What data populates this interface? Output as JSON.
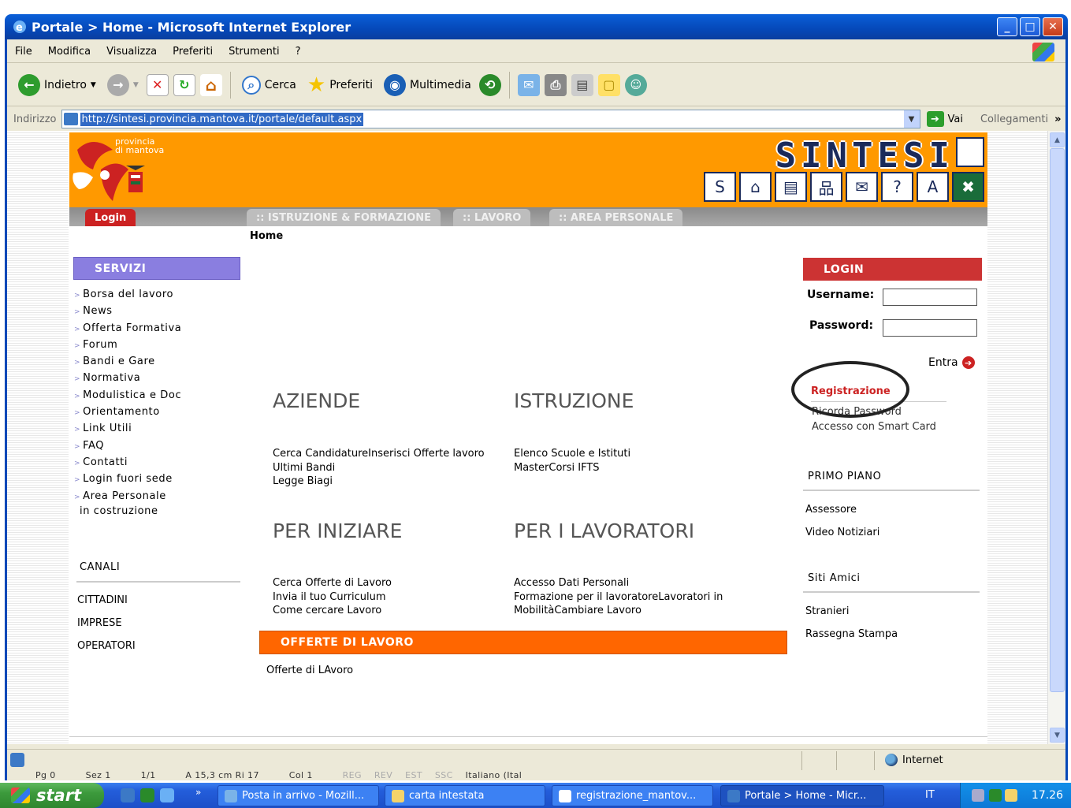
{
  "window": {
    "title": "Portale > Home - Microsoft Internet Explorer",
    "minimize": "_",
    "maximize": "□",
    "close": "✕"
  },
  "menu": [
    "File",
    "Modifica",
    "Visualizza",
    "Preferiti",
    "Strumenti",
    "?"
  ],
  "toolbar": {
    "back_label": "Indietro",
    "search_label": "Cerca",
    "favorites_label": "Preferiti",
    "media_label": "Multimedia"
  },
  "address": {
    "label": "Indirizzo",
    "url": "http://sintesi.provincia.mantova.it/portale/default.aspx",
    "go_label": "Vai",
    "links_label": "Collegamenti"
  },
  "site": {
    "brand": "SINTESI",
    "province_text_1": "provincia",
    "province_text_2": "di mantova",
    "nav": {
      "login": "Login",
      "tab1": ":: ISTRUZIONE & FORMAZIONE",
      "tab2": ":: LAVORO",
      "tab3": ":: AREA PERSONALE"
    },
    "breadcrumb": "Home"
  },
  "servizi": {
    "title": "SERVIZI",
    "items": [
      "Borsa del lavoro",
      "News",
      "Offerta Formativa",
      "Forum",
      "Bandi e Gare",
      "Normativa",
      "Modulistica e Doc",
      "Orientamento",
      "Link Utili",
      "FAQ",
      "Contatti",
      "Login fuori sede",
      "Area Personale"
    ],
    "costruzione": "in costruzione"
  },
  "canali": {
    "title": "CANALI",
    "items": [
      "CITTADINI",
      "IMPRESE",
      "OPERATORI"
    ]
  },
  "sections": {
    "aziende": {
      "title": "AZIENDE",
      "links": [
        "Cerca CandidatureInserisci Offerte lavoro",
        "Ultimi Bandi",
        "Legge Biagi"
      ]
    },
    "istruzione": {
      "title": "ISTRUZIONE",
      "links": [
        "Elenco Scuole e Istituti",
        "MasterCorsi IFTS"
      ]
    },
    "per_iniziare": {
      "title": "PER INIZIARE",
      "links": [
        "Cerca Offerte di Lavoro",
        "Invia il tuo Curriculum",
        "Come cercare Lavoro"
      ]
    },
    "per_lavoratori": {
      "title": "PER I LAVORATORI",
      "links": [
        "Accesso Dati Personali",
        "Formazione per il lavoratoreLavoratori in",
        "MobilitàCambiare Lavoro"
      ]
    }
  },
  "offerte": {
    "title": "OFFERTE DI LAVORO",
    "link": "Offerte di LAvoro"
  },
  "login": {
    "title": "LOGIN",
    "username_label": "Username:",
    "password_label": "Password:",
    "username_value": "",
    "password_value": "",
    "entra": "Entra",
    "registrazione": "Registrazione",
    "ricorda": "Ricorda Password",
    "smart_card": "Accesso con Smart Card"
  },
  "primo_piano": {
    "title": "PRIMO PIANO",
    "items": [
      "Assessore",
      "Video Notiziari"
    ]
  },
  "siti_amici": {
    "title": "Siti Amici",
    "items": [
      "Stranieri",
      "Rassegna Stampa"
    ]
  },
  "status": {
    "zone": "Internet"
  },
  "word_status": [
    "Pg 0",
    "Sez 1",
    "1/1",
    "A 15,3 cm  Ri 17",
    "Col 1",
    "REG",
    "REV",
    "EST",
    "SSC",
    "Italiano (Ital"
  ],
  "taskbar": {
    "start": "start",
    "tasks": [
      "Posta in arrivo - Mozill...",
      "carta intestata",
      "registrazione_mantov...",
      "Portale > Home - Micr..."
    ],
    "lang": "IT",
    "clock": "17.26"
  },
  "colors": {
    "banner": "#ff9900",
    "servizi": "#8a7ee0",
    "login_head": "#cc3333",
    "offerte_head": "#ff6600",
    "xp_blue": "#0548b8"
  }
}
